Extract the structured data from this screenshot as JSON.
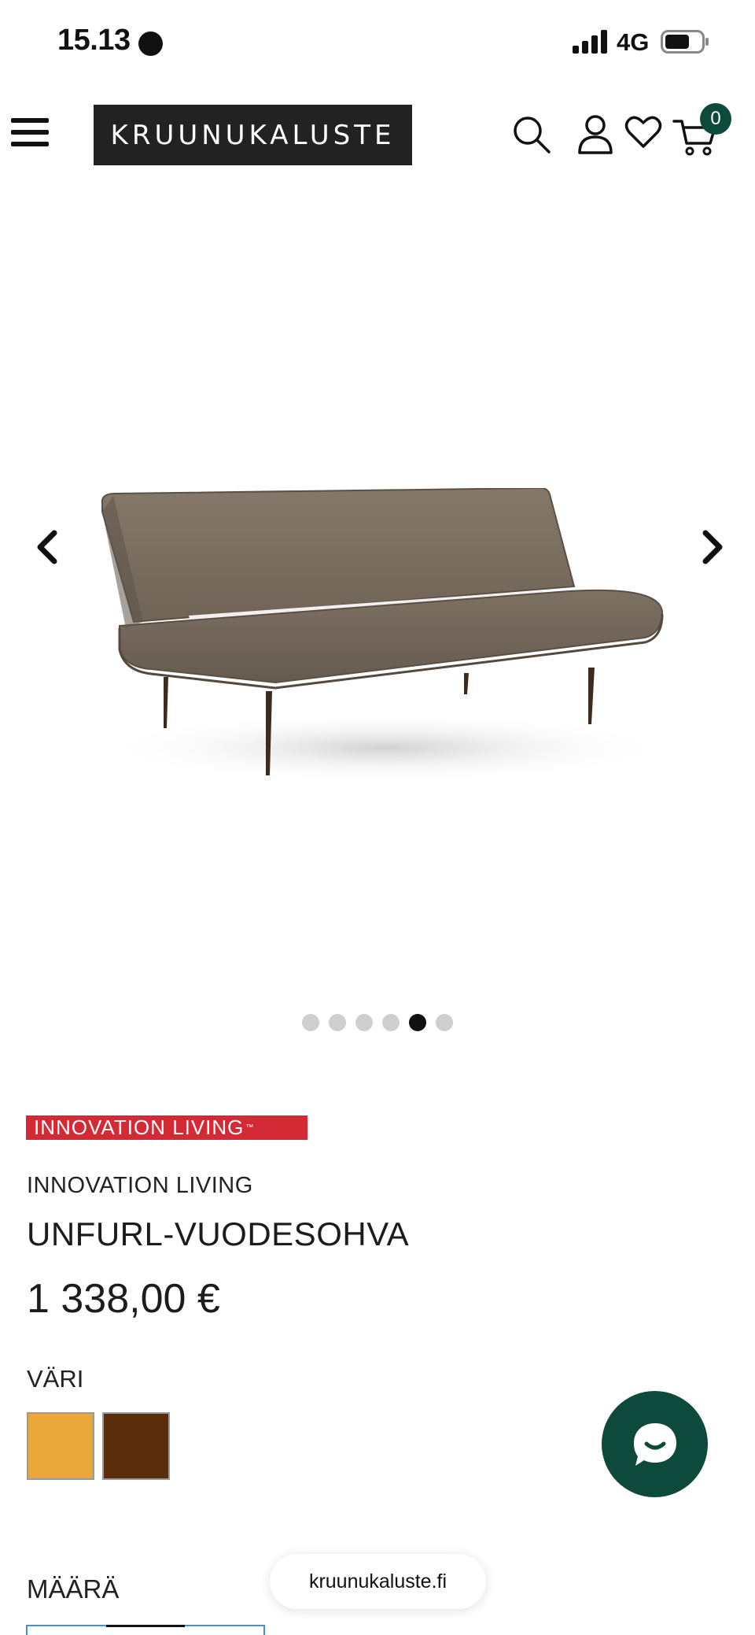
{
  "status_bar": {
    "time": "15.13",
    "network": "4G"
  },
  "header": {
    "logo_text": "KRUUNUKALUSTE",
    "cart_count": "0"
  },
  "carousel": {
    "slide_count": 6,
    "active_index": 4
  },
  "product": {
    "brand_logo_text": "INNOVATION LIVING",
    "brand_logo_mark": "™",
    "brand": "INNOVATION LIVING",
    "title": "UNFURL-VUODESOHVA",
    "price": "1 338,00 €",
    "color_label": "VÄRI",
    "colors": [
      "#e9a83a",
      "#5a2e0c"
    ],
    "quantity_label": "MÄÄRÄ"
  },
  "browser": {
    "url": "kruunukaluste.fi"
  }
}
